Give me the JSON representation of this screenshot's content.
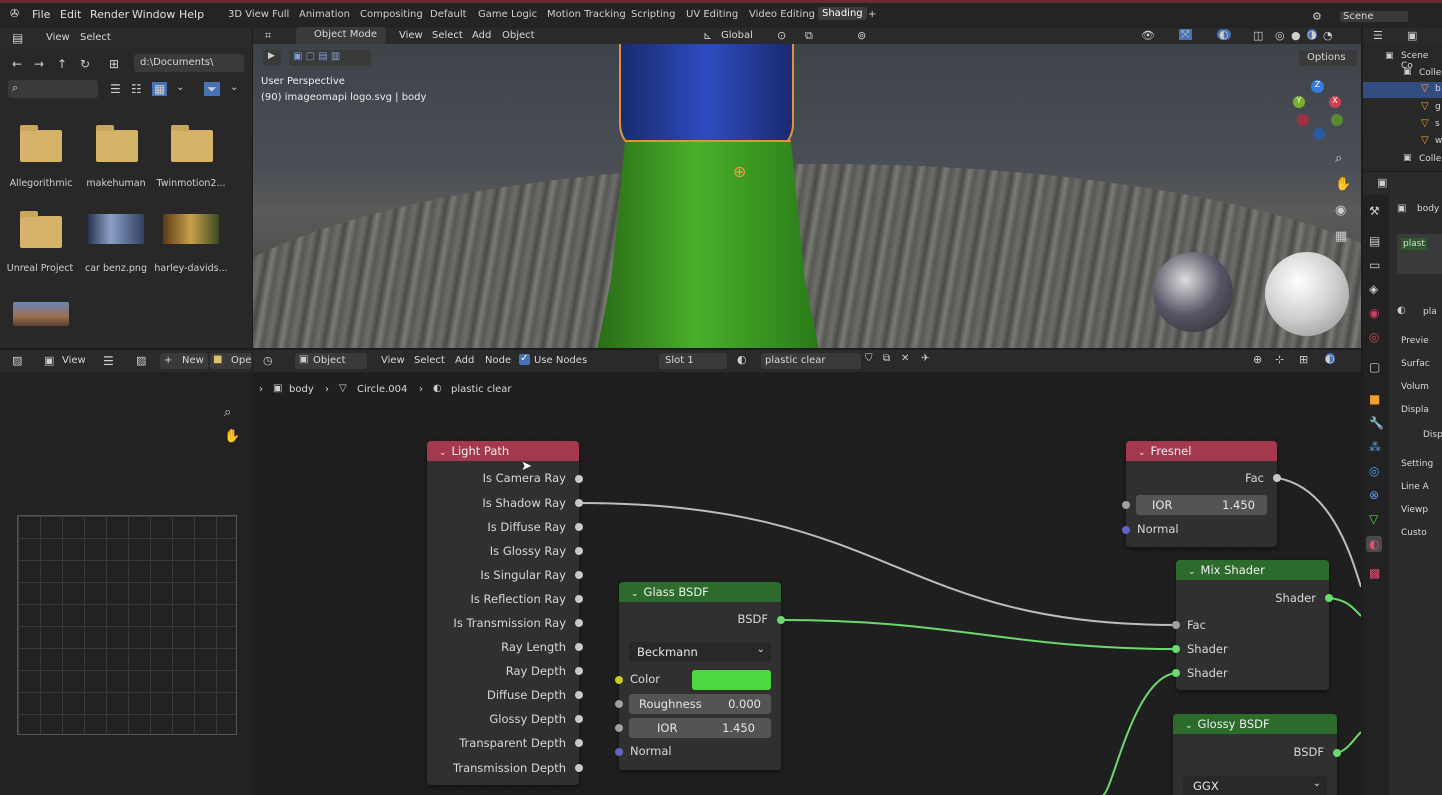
{
  "topbar": {
    "menus": [
      "File",
      "Edit",
      "Render",
      "Window",
      "Help"
    ],
    "workspaces": [
      "3D View Full",
      "Animation",
      "Compositing",
      "Default",
      "Game Logic",
      "Motion Tracking",
      "Scripting",
      "UV Editing",
      "Video Editing",
      "Shading"
    ],
    "active_workspace": "Shading",
    "add_tab": "+",
    "scene_label": "Scene"
  },
  "file_browser": {
    "menu_view": "View",
    "menu_select": "Select",
    "path": "d:\\Documents\\",
    "items": [
      {
        "label": "Allegorithmic",
        "kind": "folder"
      },
      {
        "label": "makehuman",
        "kind": "folder"
      },
      {
        "label": "Twinmotion2...",
        "kind": "folder"
      },
      {
        "label": "Unreal Project",
        "kind": "folder"
      },
      {
        "label": "car benz.png",
        "kind": "image"
      },
      {
        "label": "harley-davids...",
        "kind": "image"
      },
      {
        "label": "",
        "kind": "image"
      }
    ]
  },
  "viewport": {
    "mode": "Object Mode",
    "menus": [
      "View",
      "Select",
      "Add",
      "Object"
    ],
    "transform_orientation": "Global",
    "options_label": "Options",
    "perspective_label": "User Perspective",
    "object_info": "(90) imageomapi logo.svg | body"
  },
  "image_editor_header": {
    "view": "View",
    "new": "New",
    "open": "Ope"
  },
  "node_editor": {
    "object_type": "Object",
    "menus": [
      "View",
      "Select",
      "Add",
      "Node"
    ],
    "use_nodes_label": "Use Nodes",
    "slot": "Slot 1",
    "material": "plastic clear",
    "breadcrumb": [
      "body",
      "Circle.004",
      "plastic clear"
    ]
  },
  "nodes": {
    "light_path": {
      "title": "Light Path",
      "outputs": [
        "Is Camera Ray",
        "Is Shadow Ray",
        "Is Diffuse Ray",
        "Is Glossy Ray",
        "Is Singular Ray",
        "Is Reflection Ray",
        "Is Transmission Ray",
        "Ray Length",
        "Ray Depth",
        "Diffuse Depth",
        "Glossy Depth",
        "Transparent Depth",
        "Transmission Depth"
      ]
    },
    "glass_bsdf": {
      "title": "Glass BSDF",
      "output": "BSDF",
      "distribution": "Beckmann",
      "color_label": "Color",
      "color_value": "#4cd843",
      "roughness_label": "Roughness",
      "roughness": "0.000",
      "ior_label": "IOR",
      "ior": "1.450",
      "normal_label": "Normal"
    },
    "fresnel": {
      "title": "Fresnel",
      "output": "Fac",
      "ior_label": "IOR",
      "ior": "1.450",
      "normal_label": "Normal"
    },
    "mix_shader": {
      "title": "Mix Shader",
      "output": "Shader",
      "inputs": [
        "Fac",
        "Shader",
        "Shader"
      ]
    },
    "glossy_bsdf": {
      "title": "Glossy BSDF",
      "output": "BSDF",
      "distribution": "GGX"
    }
  },
  "outliner": {
    "items": [
      "Scene Co",
      "Colle",
      "b",
      "g",
      "s",
      "w",
      "Colle"
    ]
  },
  "properties": {
    "object": "body",
    "material": "plast",
    "material_slot": "pla",
    "panels": [
      "Previe",
      "Surfac",
      "Volum",
      "Displa",
      "Disp",
      "Setting",
      "Line A",
      "Viewp",
      "Custo"
    ]
  },
  "colors": {
    "accent_blue": "#4772b3",
    "node_header_red": "#a3384f",
    "node_header_green": "#2c6b2c",
    "shader_socket": "#6cd96c"
  }
}
